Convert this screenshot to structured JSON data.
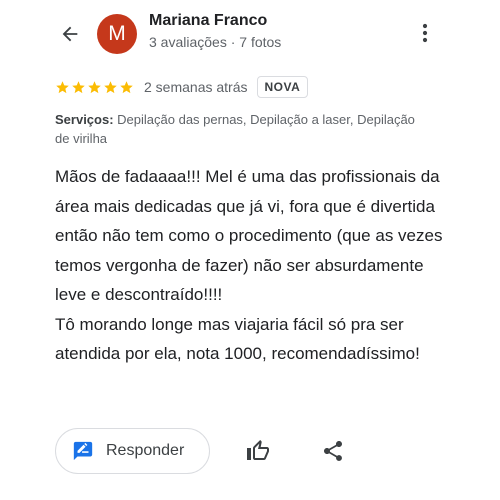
{
  "reviewer": {
    "avatar_letter": "M",
    "avatar_color": "#c5381b",
    "name": "Mariana Franco",
    "meta": "3 avaliações · 7 fotos"
  },
  "review": {
    "rating": 5,
    "rating_max": 5,
    "star_color": "#fbbc04",
    "time": "2 semanas atrás",
    "badge": "NOVA",
    "services_label": "Serviços:",
    "services_value": "Depilação das pernas, Depilação a laser, Depilação de virilha",
    "text": "Mãos de fadaaaa!!! Mel é uma das profissionais da área mais dedicadas que já vi, fora que é divertida então não tem como o procedimento (que as vezes temos vergonha de fazer) não ser absurdamente leve e descontraído!!!!\nTô morando longe mas viajaria fácil só pra ser atendida por ela, nota 1000, recomendadíssimo!"
  },
  "actions": {
    "reply_label": "Responder",
    "reply_icon": "feedback-icon",
    "like_icon": "thumb-up-icon",
    "share_icon": "share-icon",
    "accent_color": "#1a73e8"
  },
  "header": {
    "back_icon": "arrow-back-icon",
    "more_icon": "more-vert-icon"
  }
}
